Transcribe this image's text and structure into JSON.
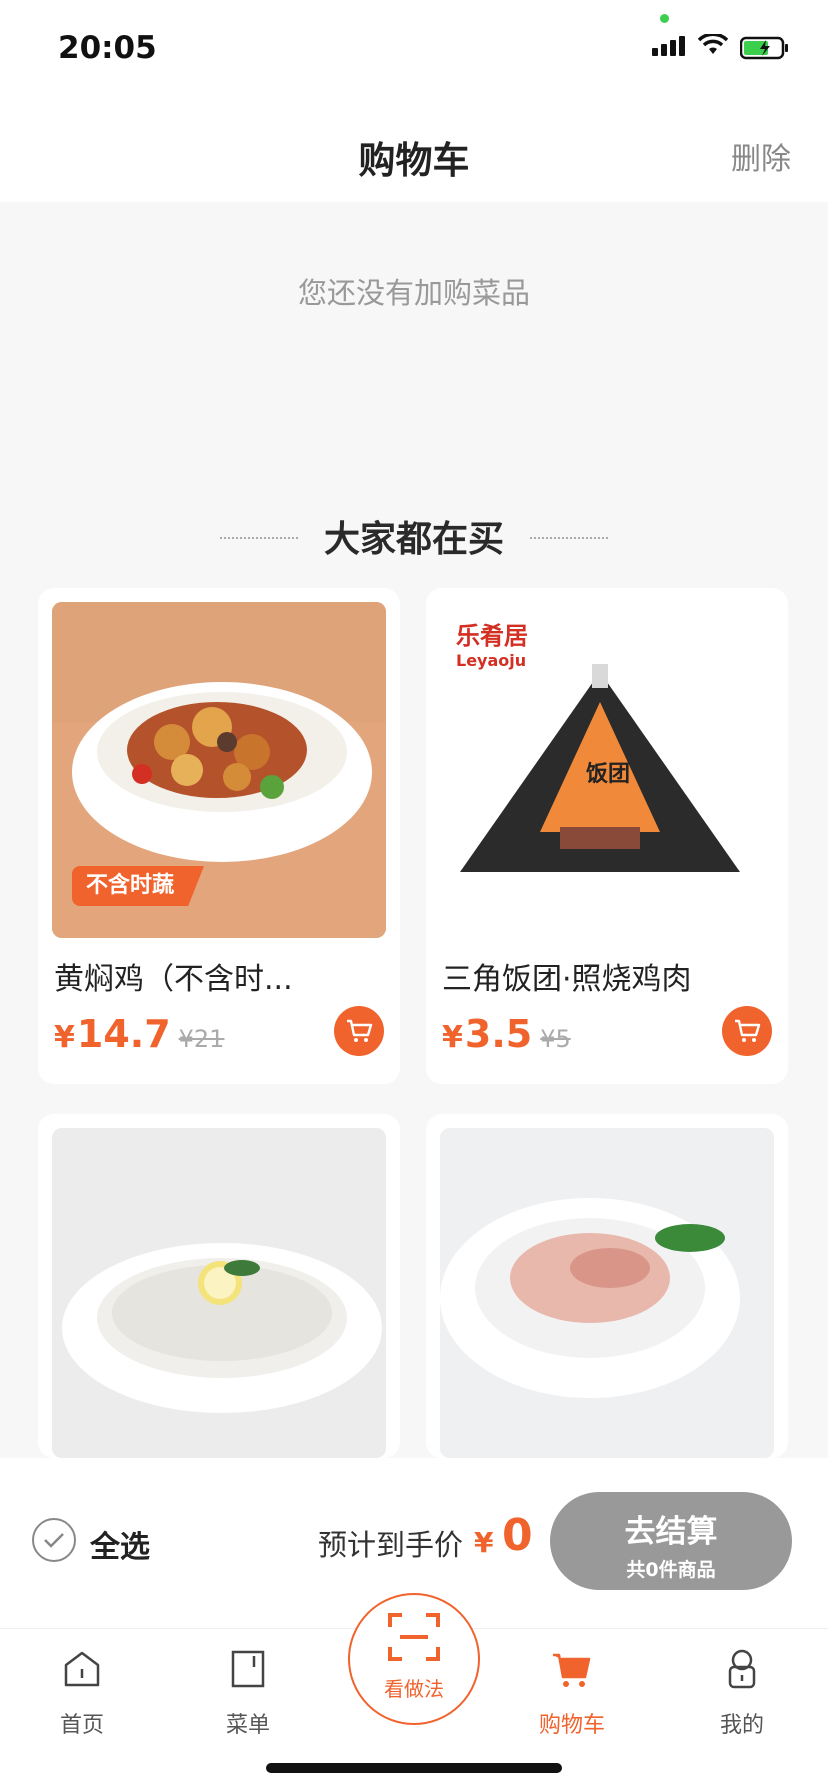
{
  "status_bar": {
    "time": "20:05"
  },
  "header": {
    "title": "购物车",
    "delete_label": "删除"
  },
  "cart": {
    "empty_text": "您还没有加购菜品"
  },
  "recommend": {
    "title": "大家都在买",
    "products": [
      {
        "name": "黄焖鸡（不含时...",
        "price": "14.7",
        "original_price": "¥21",
        "tag": "不含时蔬",
        "image": "braised-chicken-dish-photo"
      },
      {
        "name": "三角饭团·照烧鸡肉",
        "price": "3.5",
        "original_price": "¥5",
        "brand_logo": "乐肴居",
        "brand_logo_en": "Leyaoju",
        "package_text": "饭团",
        "image": "triangle-rice-ball-package-photo"
      },
      {
        "name": "",
        "image": "sliced-fish-plate-photo"
      },
      {
        "name": "",
        "image": "sliced-meat-plate-photo"
      }
    ],
    "currency": "¥"
  },
  "checkout": {
    "select_all_label": "全选",
    "estimate_label": "预计到手价",
    "currency": "¥",
    "estimate_value": "0",
    "checkout_button": "去结算",
    "checkout_sub": "共0件商品"
  },
  "tabbar": {
    "items": [
      {
        "label": "首页",
        "icon": "home-icon"
      },
      {
        "label": "菜单",
        "icon": "menu-icon"
      },
      {
        "label": "看做法",
        "icon": "scan-icon"
      },
      {
        "label": "购物车",
        "icon": "cart-icon",
        "active": true
      },
      {
        "label": "我的",
        "icon": "profile-icon"
      }
    ]
  },
  "colors": {
    "accent": "#f0632d",
    "button_disabled": "#999999"
  }
}
